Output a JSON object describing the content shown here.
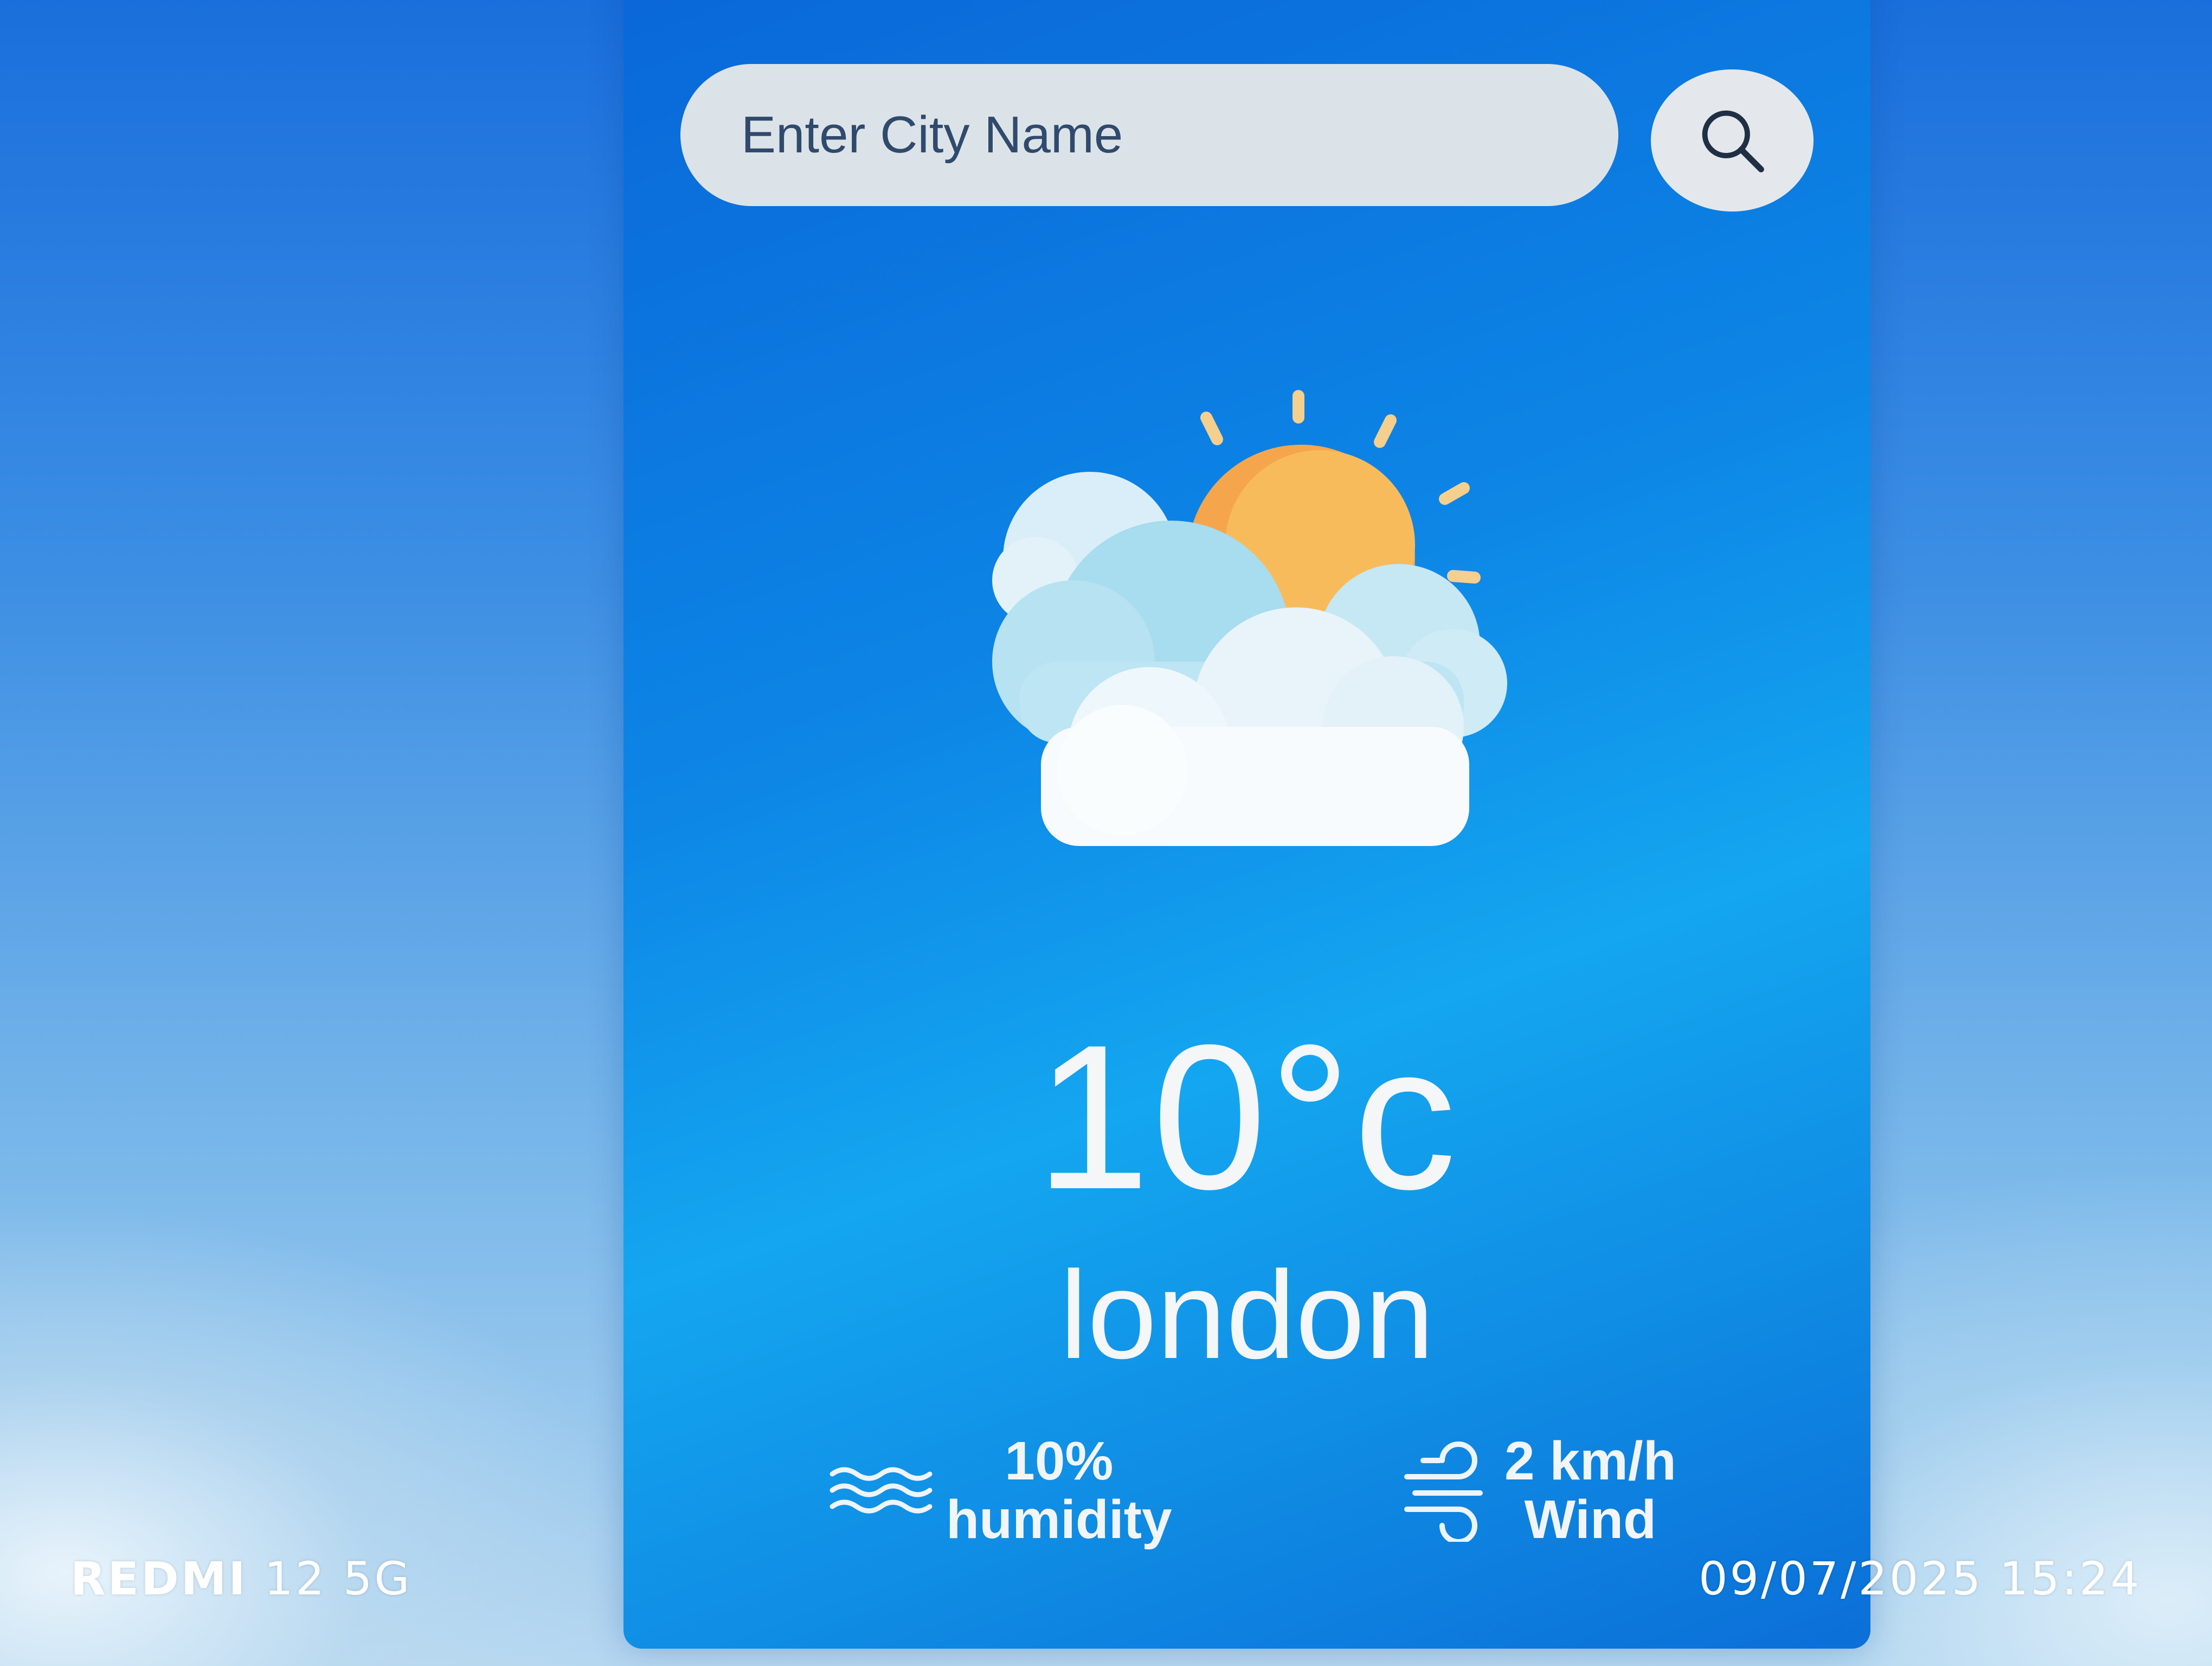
{
  "search": {
    "placeholder": "Enter City Name",
    "icon": "search-icon"
  },
  "weather": {
    "icon": "partly-cloudy-icon",
    "temperature": "10°c",
    "city": "london"
  },
  "details": {
    "humidity": {
      "icon": "humidity-waves-icon",
      "value": "10%",
      "label": "humidity"
    },
    "wind": {
      "icon": "wind-icon",
      "value": "2 km/h",
      "label": "Wind"
    }
  },
  "watermark": {
    "brand": "REDMI",
    "model": "12 5G",
    "datetime": "09/07/2025 15:24"
  },
  "colors": {
    "card_blue": "#0d86e6",
    "search_bg": "#dce3e8",
    "sun_orange": "#f6a94e",
    "text_white": "#f4f6f8"
  }
}
